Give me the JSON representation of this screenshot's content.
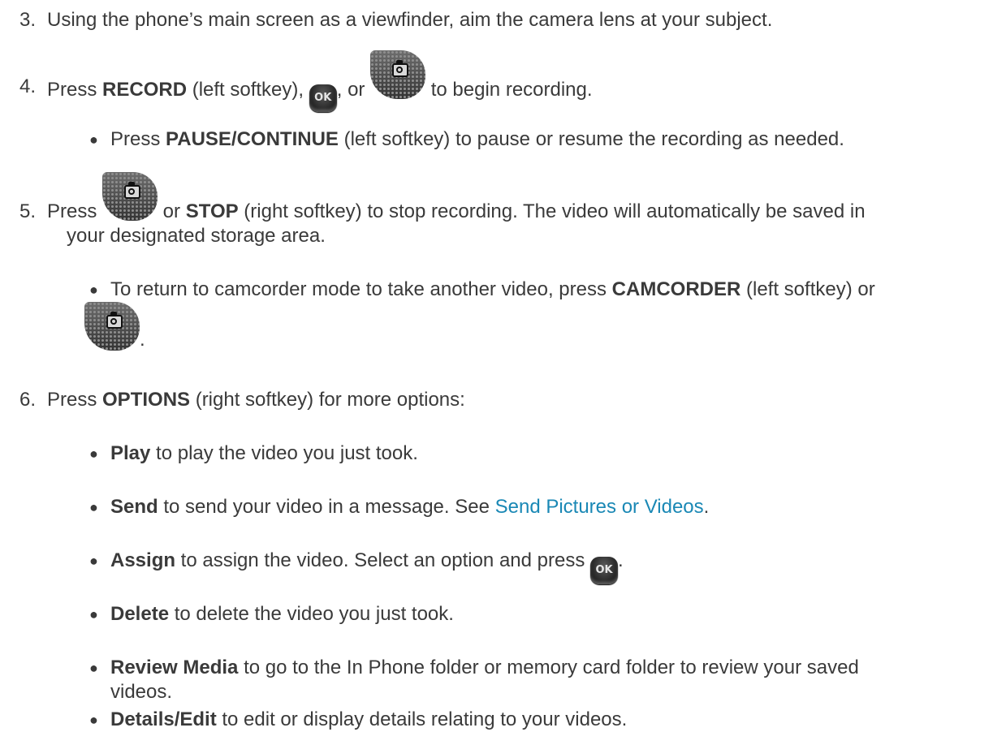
{
  "step3": {
    "num": "3.",
    "text": "Using the phone’s main screen as a viewfinder, aim the camera lens at your subject."
  },
  "step4": {
    "num": "4.",
    "pre": "Press ",
    "bold": "RECORD",
    "mid": " (left softkey), ",
    "comma_or": ", or ",
    "post": " to begin recording.",
    "ok_label": "OK"
  },
  "step4_b1": {
    "pre": "Press ",
    "bold": "PAUSE/CONTINUE",
    "post": " (left softkey) to pause or resume the recording as needed."
  },
  "step5": {
    "num": "5.",
    "pre": "Press ",
    "or": " or ",
    "bold": "STOP",
    "post": " (right softkey) to stop recording. The video will automatically be saved in",
    "line2": "your designated storage area."
  },
  "step5_b1": {
    "pre": "To return to camcorder mode to take another video, press ",
    "bold": "CAMCORDER",
    "post": " (left softkey) or",
    "end": "."
  },
  "step6": {
    "num": "6.",
    "pre": "Press ",
    "bold": "OPTIONS",
    "post": " (right softkey) for more options:"
  },
  "options": {
    "play": {
      "bold": "Play",
      "text": " to play the video you just took."
    },
    "send": {
      "bold": "Send",
      "text": " to send your video in a message. See ",
      "link": "Send Pictures or Videos",
      "end": "."
    },
    "assign": {
      "bold": "Assign",
      "text": " to assign the video. Select an option and press ",
      "ok_label": "OK",
      "end": "."
    },
    "delete": {
      "bold": "Delete",
      "text": " to delete the video you just took."
    },
    "review": {
      "bold": "Review Media",
      "text": " to go to the In Phone folder or memory card folder to review your saved",
      "line2": "videos."
    },
    "details": {
      "bold": "Details/Edit",
      "text": " to edit or display details relating to your videos."
    }
  },
  "bullet_char": "●",
  "icons": {
    "ok": "ok-key-icon",
    "camera": "camera-key-icon"
  }
}
